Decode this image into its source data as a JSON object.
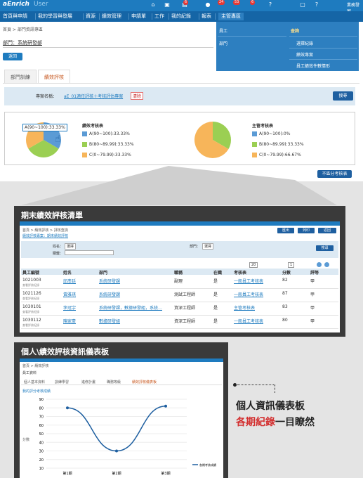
{
  "app": {
    "logo": "aEnrich",
    "logo2": "User"
  },
  "topbar": {
    "badges": [
      "6",
      "24",
      "53",
      "6"
    ],
    "user_label": "業務發展"
  },
  "menu": {
    "items": [
      "首頁與申請",
      "我的學習與發展",
      "資源",
      "績效管理",
      "申請單",
      "工作",
      "我的紀錄",
      "報表",
      "主管專區"
    ]
  },
  "dropdown": {
    "left": [
      "員工",
      "部門"
    ],
    "right_header": "查詢",
    "right": [
      "選擇紀錄",
      "績效專案",
      "員工績效件數情形"
    ]
  },
  "breadcrumb": "首頁 > 部門資訊專區",
  "department": "部門：系統研發部",
  "back_button": "返回",
  "tabs": [
    "部門訓練",
    "績效評核"
  ],
  "filter": {
    "label": "專案名稱：",
    "value": "aE_01適任評核＋考核評估專案",
    "clear": "清除",
    "search": "搜尋"
  },
  "charts": {
    "left": {
      "title": "績效考核表",
      "legend": [
        "A(90~100):33.33%",
        "B(80~89.99):33.33%",
        "C(0~79.99):33.33%"
      ],
      "tooltip": "A(90~100):33.33%"
    },
    "right": {
      "title": "主管考核表",
      "legend": [
        "A(90~100):0%",
        "B(80~89.99):33.33%",
        "C(0~79.99):66.67%"
      ]
    },
    "colors": {
      "A": "#5b9bd5",
      "B": "#9bcf53",
      "C": "#f7b55a"
    }
  },
  "chart_data": [
    {
      "type": "pie",
      "title": "績效考核表",
      "categories": [
        "A(90~100)",
        "B(80~89.99)",
        "C(0~79.99)"
      ],
      "values": [
        33.33,
        33.33,
        33.33
      ]
    },
    {
      "type": "pie",
      "title": "主管考核表",
      "categories": [
        "A(90~100)",
        "B(80~89.99)",
        "C(0~79.99)"
      ],
      "values": [
        0,
        33.33,
        66.67
      ]
    },
    {
      "type": "line",
      "title": "我的評分考核成績",
      "categories": [
        "第1期",
        "第2期",
        "第3期"
      ],
      "series": [
        {
          "name": "各期考核成績",
          "values": [
            80,
            30,
            82
          ]
        }
      ],
      "ylim": [
        10,
        90
      ],
      "yticks": [
        10,
        20,
        30,
        40,
        50,
        60,
        70,
        80,
        90
      ]
    }
  ],
  "not_distinguish_button": "不區分考核表",
  "panel1": {
    "title": "期末績效評核清單",
    "crumb": "首頁 > 績效評核 > 評核查詢",
    "subtitle": "績效評核專案：期末績效評核",
    "buttons": [
      "匯出",
      "列印",
      "返回"
    ],
    "name_label": "姓名：",
    "dept_label": "部門：",
    "keyword_label": "關鍵：",
    "choose": "選擇",
    "search": "搜尋",
    "paging": "20",
    "page": "1",
    "columns": [
      "員工編號",
      "姓名",
      "部門",
      "職稱",
      "在職",
      "考核表",
      "分數",
      "評等"
    ],
    "rows": [
      [
        "1021003",
        "邱彥廷",
        "系統研發課",
        "副理",
        "是",
        "一般員工考核表",
        "82",
        "甲"
      ],
      [
        "1021126",
        "黃雅琪",
        "系統研發課",
        "測試工程師",
        "是",
        "一般員工考核表",
        "87",
        "甲"
      ],
      [
        "1030101",
        "李冠宇",
        "系統研發課，數據研發組，系統…",
        "資深工程師",
        "是",
        "主管考核表",
        "83",
        "甲"
      ],
      [
        "1030112",
        "陳家豪",
        "數據研發組",
        "資深工程師",
        "是",
        "一般員工考核表",
        "80",
        "甲"
      ]
    ],
    "row_sub": "查看評核紀錄"
  },
  "panel2": {
    "title": "個人\\績效評核資訊儀表板",
    "crumb": "首頁 > 績效評核",
    "section": "員工資料",
    "tabs": [
      "個人基本資料",
      "訓練學習",
      "進修計畫",
      "職務等級",
      "績效評核儀表板"
    ],
    "chart_title": "我的評分考核成績",
    "y_label": "分數"
  },
  "side": {
    "line1": "個人資訊儀表板",
    "line2_red": "各期紀錄",
    "line2_rest": "一目瞭然"
  }
}
